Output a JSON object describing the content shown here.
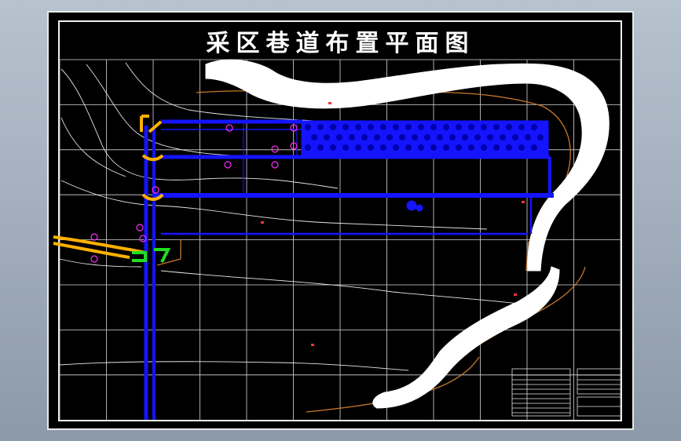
{
  "title": "采区巷道布置平面图",
  "colors": {
    "sheet_bg": "#000000",
    "grid": "#d8d8d8",
    "roadway": "#1414ff",
    "contour": "#e6e6e6",
    "boundary": "#c8782c",
    "shaft_marker": "#ffb000",
    "magenta": "#ff2cff",
    "green": "#22dd22",
    "river": "#ffffff"
  }
}
